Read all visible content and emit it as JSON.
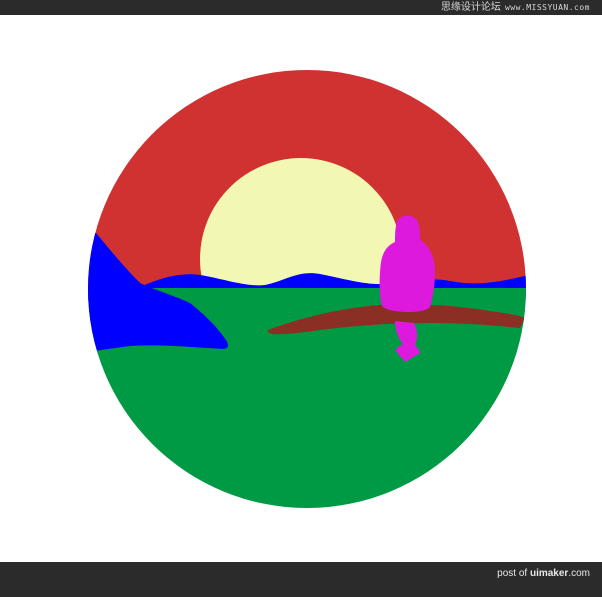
{
  "header": {
    "site_name": "思缘设计论坛",
    "site_url": "www.MISSYUAN.com"
  },
  "footer": {
    "prefix": "post of",
    "brand": "uimaker",
    "suffix": ".com"
  },
  "colors": {
    "sky": "#d03232",
    "sun": "#f2f8b4",
    "water": "#0000ff",
    "grass": "#009a44",
    "branch": "#8b2e24",
    "figure": "#dd19dd",
    "bars": "#2b2b2b"
  }
}
